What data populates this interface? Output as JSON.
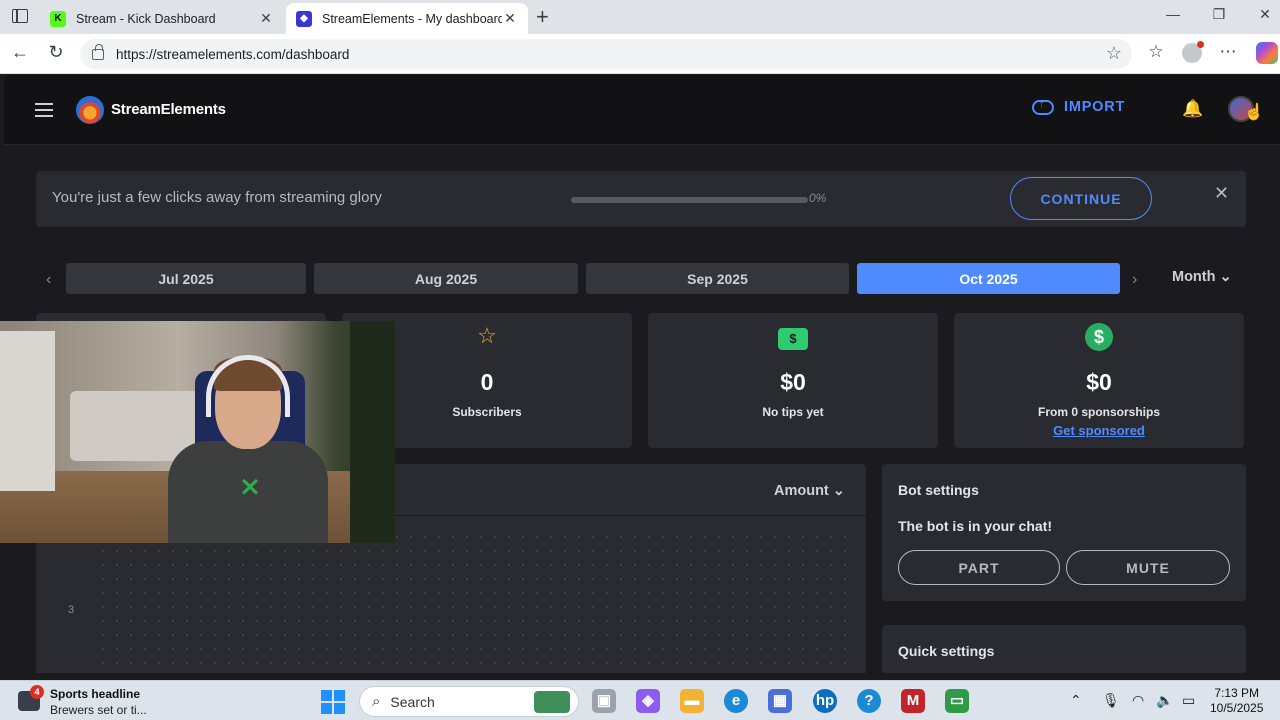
{
  "browser": {
    "tabs": [
      {
        "title": "Stream - Kick Dashboard",
        "favicon": "kick-icon",
        "color": "#53fc18"
      },
      {
        "title": "StreamElements - My dashboard",
        "favicon": "streamelements-icon",
        "color": "#3b37d6",
        "active": true
      }
    ],
    "url": "https://streamelements.com/dashboard"
  },
  "app": {
    "brand": "StreamElements",
    "import_label": "IMPORT",
    "banner": {
      "message": "You're just a few clicks away from streaming glory",
      "progress": 0,
      "progress_label": "0%",
      "continue_label": "CONTINUE"
    },
    "months": [
      "Jul 2025",
      "Aug 2025",
      "Sep 2025",
      "Oct 2025"
    ],
    "active_month": "Oct 2025",
    "period_label": "Month",
    "stats": [
      {
        "icon": "star-icon",
        "value": "0",
        "label": "Subscribers"
      },
      {
        "icon": "cash-icon",
        "value": "$0",
        "label": "No tips yet"
      },
      {
        "icon": "dollar-icon",
        "value": "$0",
        "label": "From 0 sponsorships",
        "link": "Get sponsored"
      }
    ],
    "chart": {
      "sort_label": "Amount",
      "y_tick": "3"
    },
    "bot": {
      "title": "Bot settings",
      "status": "The bot is in your chat!",
      "part_label": "PART",
      "mute_label": "MUTE"
    },
    "quick_settings_title": "Quick settings",
    "accent_color": "#4f8bff"
  },
  "taskbar": {
    "news_headline": "Sports headline",
    "news_sub": "Brewers set or ti...",
    "news_badge": "4",
    "search_placeholder": "Search",
    "time": "7:13 PM",
    "date": "10/5/2025"
  }
}
